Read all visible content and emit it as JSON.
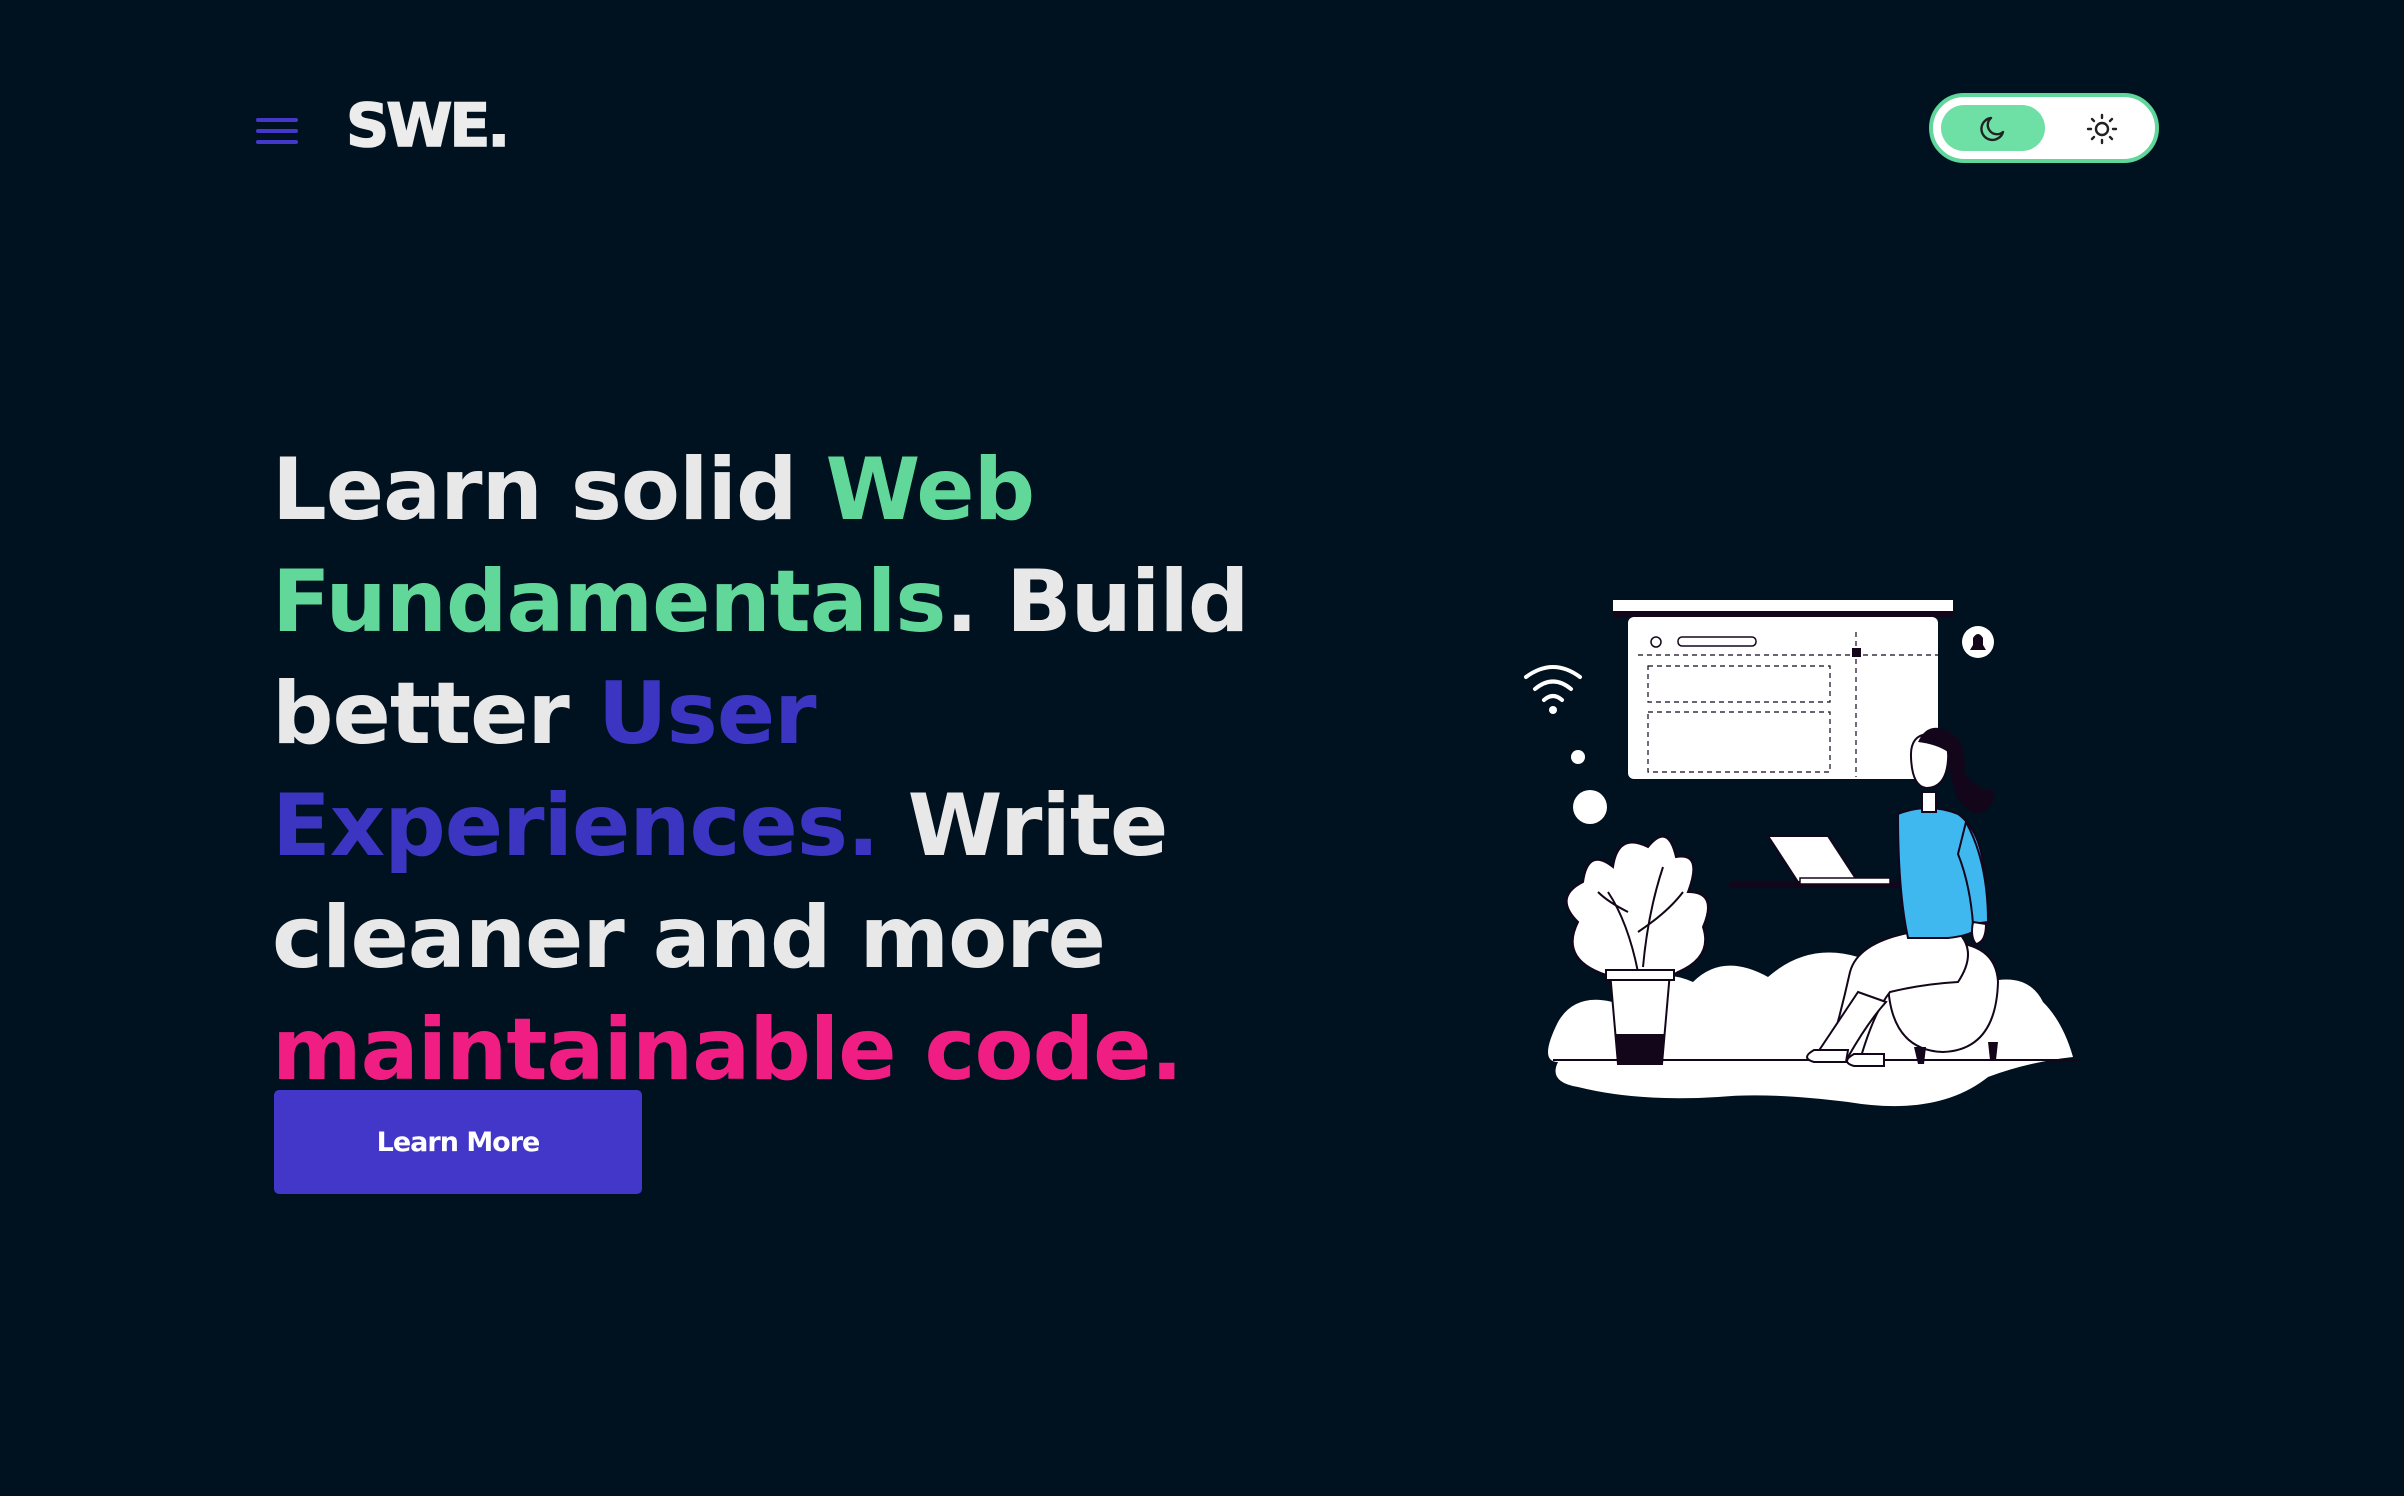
{
  "header": {
    "menu_icon": "hamburger-menu-icon",
    "logo": "SWE."
  },
  "theme_toggle": {
    "dark_icon": "moon-icon",
    "light_icon": "sun-icon",
    "active": "dark",
    "colors": {
      "track": "#ffffff",
      "knob": "#6ee0a5",
      "border": "#5fd69a"
    }
  },
  "hero": {
    "headline": {
      "part1": "Learn solid ",
      "part2": "Web Fundamentals",
      "part3": ". Build better ",
      "part4": "User Experiences.",
      "part5": " Write cleaner and more ",
      "part6": "maintainable code."
    },
    "cta_label": "Learn More",
    "illustration": "woman-with-laptop-illustration"
  },
  "colors": {
    "background": "#00111f",
    "text": "#e8e8e8",
    "accent_green": "#62d79a",
    "accent_blue": "#3b35c2",
    "accent_pink": "#f01e82",
    "button": "#4237c9"
  }
}
